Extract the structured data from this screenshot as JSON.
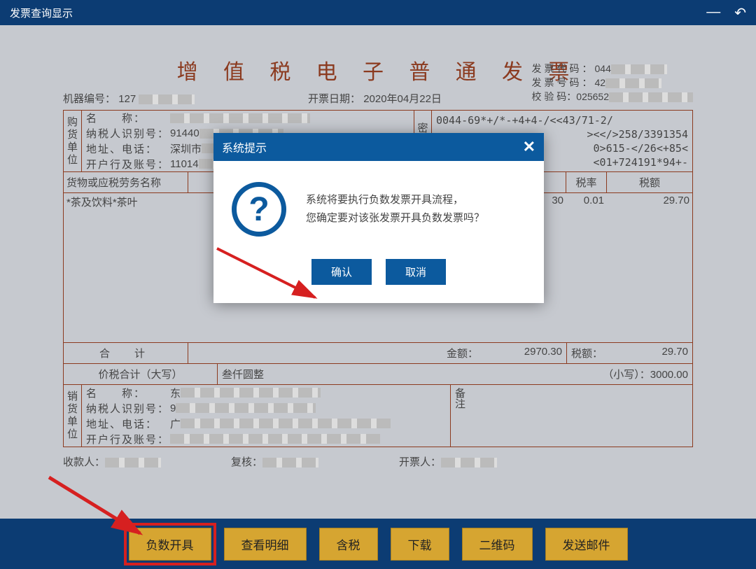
{
  "titlebar": {
    "title": "发票查询显示"
  },
  "doc": {
    "title": "增 值 税 电 子 普 通 发 票",
    "machine_label": "机器编号：",
    "machine_value": "127",
    "date_label": "开票日期：",
    "date_value": "2020年04月22日",
    "code_label": "发票代码：",
    "code_value": "044",
    "num_label": "发票号码：",
    "num_value": "42",
    "check_label": "校 验 码：",
    "check_value": "025652"
  },
  "buyer": {
    "side": "购货单位",
    "name_label": "名　　称：",
    "name_value": "",
    "taxno_label": "纳税人识别号：",
    "taxno_value": "91440",
    "addr_label": "地址、电话：",
    "addr_value": "深圳市",
    "bank_label": "开户行及账号：",
    "bank_value": "11014"
  },
  "cipher": {
    "side": "密码区",
    "line1": "0044-69*+/*-+4+4-/<<43/71-2/",
    "line2": "><</>258/3391354",
    "line3": "0>615-</26<+85<",
    "line4": "<01+724191*94+-"
  },
  "items_head": {
    "name": "货物或应税劳务名称",
    "rate": "税率",
    "tax": "税额"
  },
  "item1": {
    "name": "*茶及饮料*茶叶",
    "amount_suffix": "30",
    "rate": "0.01",
    "tax": "29.70"
  },
  "sum_row": {
    "label": "合　计",
    "amount_label": "金额：",
    "amount": "2970.30",
    "tax_label": "税额：",
    "tax": "29.70"
  },
  "total_row": {
    "label": "价税合计（大写）",
    "cn": "叁仟圆整",
    "small_label": "（小写）：",
    "small_value": "3000.00"
  },
  "seller": {
    "side": "销货单位",
    "name_label": "名　　称：",
    "taxno_label": "纳税人识别号：",
    "addr_label": "地址、电话：",
    "bank_label": "开户行及账号：",
    "note": "备注"
  },
  "sign": {
    "payee": "收款人：",
    "review": "复核：",
    "drawer": "开票人："
  },
  "footer": {
    "neg": "负数开具",
    "detail": "查看明细",
    "tax": "含税",
    "download": "下载",
    "qr": "二维码",
    "mail": "发送邮件"
  },
  "modal": {
    "title": "系统提示",
    "line1": "系统将要执行负数发票开具流程，",
    "line2": "您确定要对该张发票开具负数发票吗？",
    "ok": "确认",
    "cancel": "取消"
  }
}
